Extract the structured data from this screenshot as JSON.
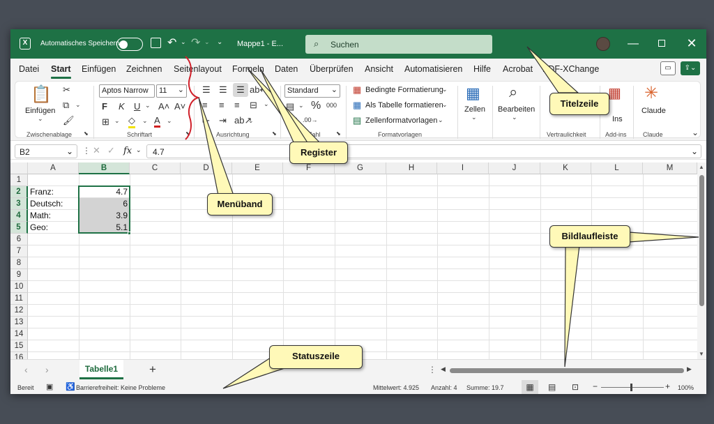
{
  "title_bar": {
    "autosave_label": "Automatisches Speichern",
    "doc_title": "Mappe1 - E...",
    "search_placeholder": "Suchen"
  },
  "tabs": [
    "Datei",
    "Start",
    "Einfügen",
    "Zeichnen",
    "Seitenlayout",
    "Formeln",
    "Daten",
    "Überprüfen",
    "Ansicht",
    "Automatisieren",
    "Hilfe",
    "Acrobat",
    "PDF-XChange"
  ],
  "active_tab": "Start",
  "ribbon": {
    "paste_label": "Einfügen",
    "font_name": "Aptos Narrow",
    "font_size": "11",
    "number_format": "Standard",
    "cond_format": "Bedingte Formatierung",
    "as_table": "Als Tabelle formatieren",
    "cell_styles": "Zellenformatvorlagen",
    "cells_label": "Zellen",
    "edit_label": "Bearbeiten",
    "claude_label": "Claude",
    "groups": {
      "clipboard": "Zwischenablage",
      "font": "Schriftart",
      "alignment": "Ausrichtung",
      "number": "Zahl",
      "styles": "Formatvorlagen",
      "sensitivity": "Vertraulichkeit",
      "addins": "Add-ins",
      "claude": "Claude"
    },
    "addins_partial": "Ins"
  },
  "formula_bar": {
    "name_box": "B2",
    "fx": "fx",
    "value": "4.7"
  },
  "columns": [
    "A",
    "B",
    "C",
    "D",
    "E",
    "F",
    "G",
    "H",
    "I",
    "J",
    "K",
    "L",
    "M"
  ],
  "selected_column": "B",
  "rows": [
    "1",
    "2",
    "3",
    "4",
    "5",
    "6",
    "7",
    "8",
    "9",
    "10",
    "11",
    "12",
    "13",
    "14",
    "15",
    "16"
  ],
  "cells": {
    "a2": "Franz:",
    "b2": "4.7",
    "a3": "Deutsch:",
    "b3": "6",
    "a4": "Math:",
    "b4": "3.9",
    "a5": "Geo:",
    "b5": "5.1"
  },
  "sheet_tab": "Tabelle1",
  "add_sheet": "+",
  "status": {
    "ready": "Bereit",
    "accessibility": "Barrierefreiheit: Keine Probleme",
    "average": "Mittelwert: 4.925",
    "count": "Anzahl: 4",
    "sum": "Summe: 19.7",
    "zoom": "100%",
    "zoom_minus": "−",
    "zoom_plus": "+"
  },
  "callouts": {
    "titelzeile": "Titelzeile",
    "register": "Register",
    "menuband": "Menüband",
    "bildlaufleiste": "Bildlaufleiste",
    "statuszeile": "Statuszeile"
  },
  "colors": {
    "accent": "#1e7145",
    "callout_fill": "#fff9b8",
    "brace": "#d0202a"
  }
}
